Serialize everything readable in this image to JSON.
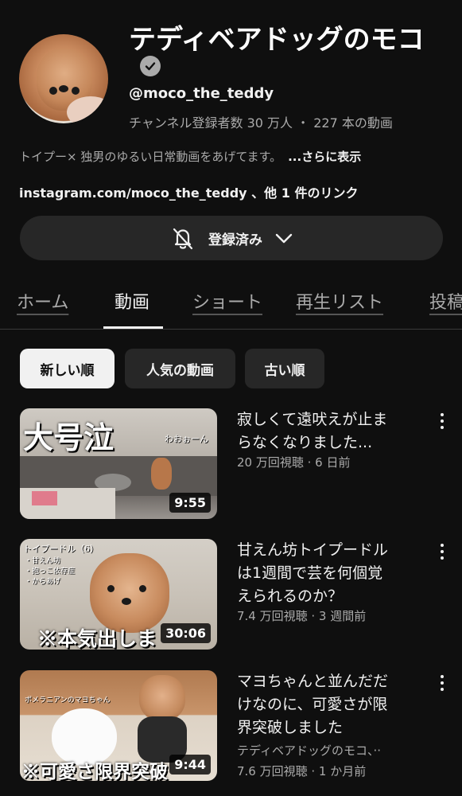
{
  "channel": {
    "name": "テディベアドッグのモコ",
    "handle": "@moco_the_teddy",
    "stats": "チャンネル登録者数 30 万人 ・ 227 本の動画",
    "description": "トイプー× 独男のゆるい日常動画をあげてます。",
    "more_label": "...さらに表示",
    "links": "instagram.com/moco_the_teddy 、他 1 件のリンク",
    "subscribe_label": "登録済み"
  },
  "tabs": [
    {
      "label": "ホーム",
      "active": false
    },
    {
      "label": "動画",
      "active": true
    },
    {
      "label": "ショート",
      "active": false
    },
    {
      "label": "再生リスト",
      "active": false
    },
    {
      "label": "投稿",
      "active": false
    }
  ],
  "chips": [
    {
      "label": "新しい順",
      "active": true
    },
    {
      "label": "人気の動画",
      "active": false
    },
    {
      "label": "古い順",
      "active": false
    }
  ],
  "videos": [
    {
      "title_line1": "寂しくて遠吠えが止ま",
      "title_line2": "らなくなりました...",
      "meta": "20 万回視聴 · 6 日前",
      "duration": "9:55",
      "thumb_text_big": "大号泣",
      "thumb_text_small": "わおぉーん"
    },
    {
      "title_line1": "甘えん坊トイプードル",
      "title_line2": "は1週間で芸を何個覚",
      "title_line3": "えられるのか？",
      "meta": "7.4 万回視聴 · 3 週間前",
      "duration": "30:06",
      "thumb_text_big": "※本気出しま",
      "thumb_text_small": "トイプードル（6）",
      "thumb_list": [
        "・甘えん坊",
        "・抱っこ依存症",
        "・からあげ"
      ]
    },
    {
      "title_line1": "マヨちゃんと並んだだ",
      "title_line2": "けなのに、可愛さが限",
      "title_line3": "界突破しました",
      "channel": "テディベアドッグのモコ、··",
      "meta": "7.6 万回視聴 · 1 か月前",
      "duration": "9:44",
      "thumb_text_big": "※可愛さ限界突破",
      "thumb_text_small": "ポメラニアンのマヨちゃん"
    }
  ]
}
